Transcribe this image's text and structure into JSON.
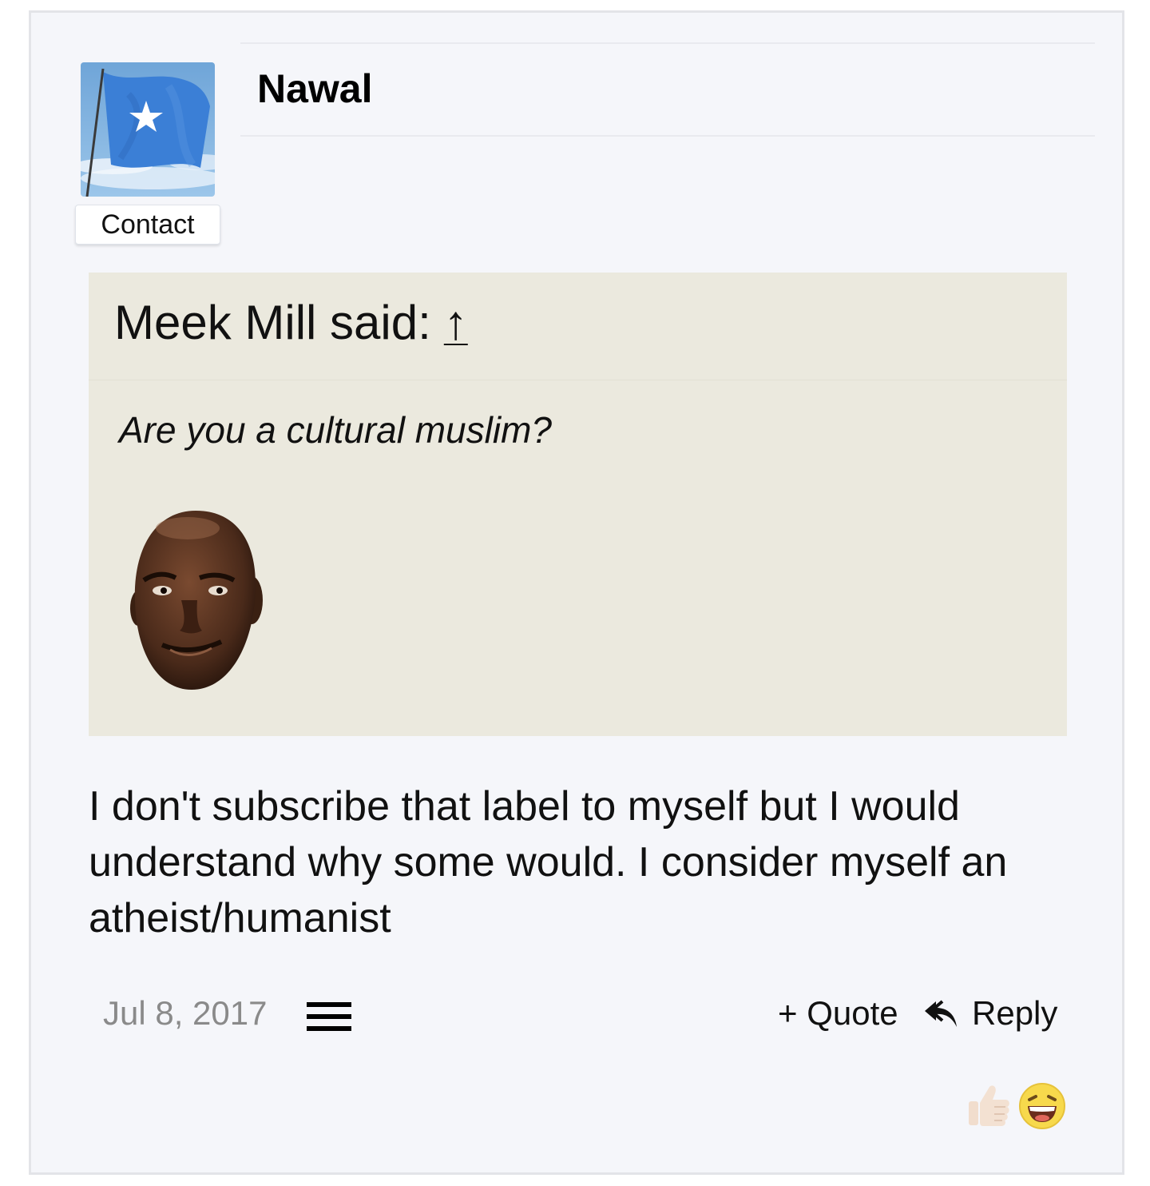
{
  "post": {
    "author": "Nawal",
    "contact_label": "Contact",
    "quote": {
      "author_line": "Meek Mill said:",
      "jump_arrow": "↑",
      "text": "Are you a cultural muslim?"
    },
    "body": "I don't subscribe that label to myself but I would understand why some would. I consider myself an atheist/humanist",
    "date": "Jul 8, 2017",
    "actions": {
      "quote_label": "+ Quote",
      "reply_label": "Reply"
    },
    "reactions": [
      "thumbs-up-icon",
      "laughing-face-icon"
    ]
  },
  "colors": {
    "card_background": "#f5f6fa",
    "quote_background": "#ebe9de",
    "date_color": "#8a8a8a",
    "flag_blue": "#3b7fd6"
  }
}
